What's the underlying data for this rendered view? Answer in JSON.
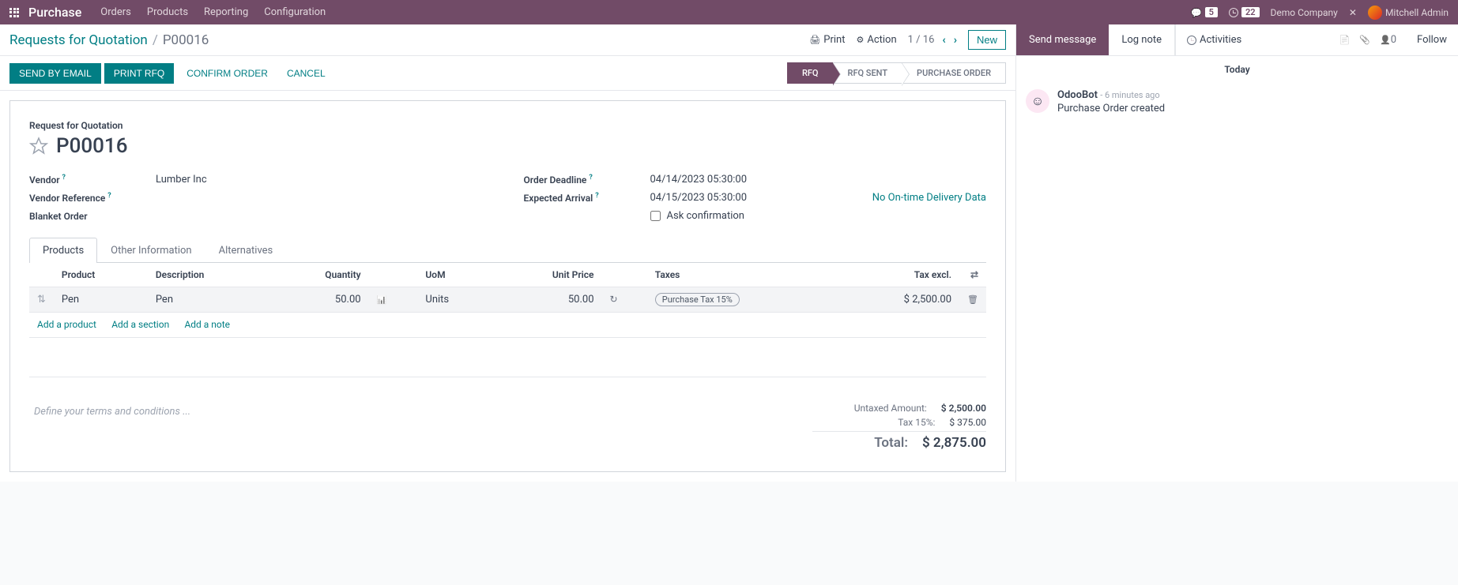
{
  "topnav": {
    "brand": "Purchase",
    "items": [
      "Orders",
      "Products",
      "Reporting",
      "Configuration"
    ],
    "chat_count": "5",
    "clock_count": "22",
    "company": "Demo Company",
    "user": "Mitchell Admin"
  },
  "header": {
    "breadcrumb_root": "Requests for Quotation",
    "breadcrumb_current": "P00016",
    "print": "Print",
    "action": "Action",
    "pager": "1 / 16",
    "new_btn": "New"
  },
  "actions": {
    "send_email": "SEND BY EMAIL",
    "print_rfq": "PRINT RFQ",
    "confirm": "CONFIRM ORDER",
    "cancel": "CANCEL",
    "status": [
      "RFQ",
      "RFQ SENT",
      "PURCHASE ORDER"
    ]
  },
  "form": {
    "title_label": "Request for Quotation",
    "doc_number": "P00016",
    "vendor_label": "Vendor",
    "vendor": "Lumber Inc",
    "vendor_ref_label": "Vendor Reference",
    "blanket_label": "Blanket Order",
    "deadline_label": "Order Deadline",
    "deadline": "04/14/2023 05:30:00",
    "arrival_label": "Expected Arrival",
    "arrival": "04/15/2023 05:30:00",
    "ontime_link": "No On-time Delivery Data",
    "ask_confirm": "Ask confirmation"
  },
  "tabs": [
    "Products",
    "Other Information",
    "Alternatives"
  ],
  "table": {
    "headers": {
      "product": "Product",
      "description": "Description",
      "quantity": "Quantity",
      "uom": "UoM",
      "unit_price": "Unit Price",
      "taxes": "Taxes",
      "tax_excl": "Tax excl."
    },
    "rows": [
      {
        "product": "Pen",
        "description": "Pen",
        "quantity": "50.00",
        "uom": "Units",
        "unit_price": "50.00",
        "tax": "Purchase Tax 15%",
        "tax_excl": "$ 2,500.00"
      }
    ],
    "add_product": "Add a product",
    "add_section": "Add a section",
    "add_note": "Add a note"
  },
  "terms_placeholder": "Define your terms and conditions ...",
  "totals": {
    "untaxed_label": "Untaxed Amount:",
    "untaxed": "$ 2,500.00",
    "tax_label": "Tax 15%:",
    "tax": "$ 375.00",
    "total_label": "Total:",
    "total": "$ 2,875.00"
  },
  "chatter": {
    "send": "Send message",
    "log": "Log note",
    "activities": "Activities",
    "follower_count": "0",
    "follow": "Follow",
    "date": "Today",
    "msg_author": "OdooBot",
    "msg_time": "- 6 minutes ago",
    "msg_text": "Purchase Order created"
  }
}
